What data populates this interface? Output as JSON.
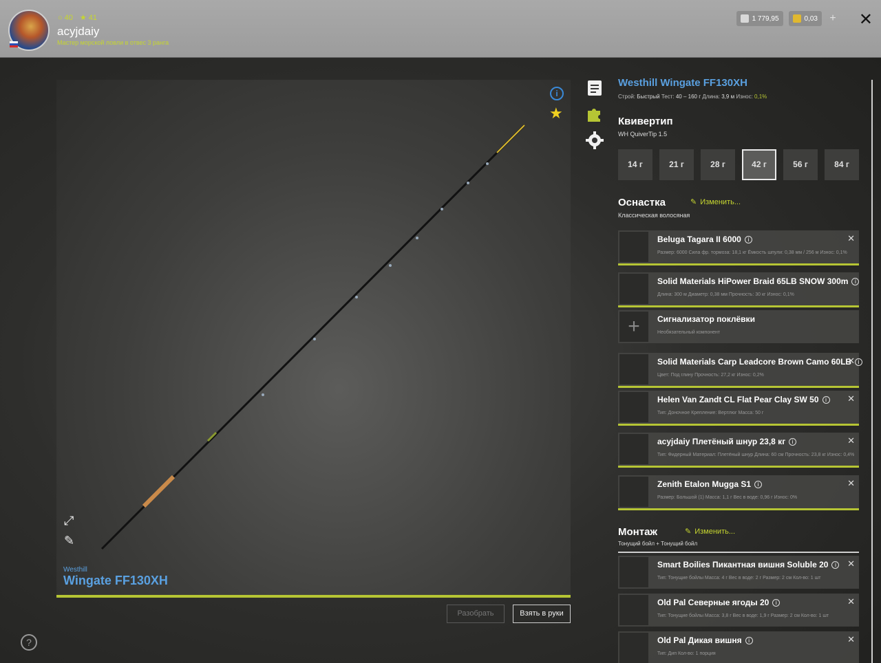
{
  "header": {
    "level": "40",
    "stars": "41",
    "username": "acyjdaiy",
    "rank": "Мастер морской ловли в отвес 3 ранга",
    "silver": "1 779,95",
    "gold": "0,03",
    "plus_label": "+",
    "close_label": "✕"
  },
  "viewer": {
    "brand": "Westhill",
    "model": "Wingate FF130XH",
    "disassemble_label": "Разобрать",
    "take_label": "Взять в руки",
    "help_label": "?"
  },
  "rod": {
    "title": "Westhill Wingate FF130XH",
    "specs_prefix_1": "Строй: ",
    "action": "Быстрый",
    "specs_prefix_2": "Тест: ",
    "test": "40 – 160 г",
    "specs_prefix_3": "Длина: ",
    "length": "3,9 м",
    "specs_prefix_4": "Износ: ",
    "wear": "0,1%"
  },
  "quivertip": {
    "heading": "Квивертип",
    "name": "WH QuiverTip 1.5",
    "options": [
      "14 г",
      "21 г",
      "28 г",
      "42 г",
      "56 г",
      "84 г"
    ],
    "selected_index": 3
  },
  "tackle": {
    "heading": "Оснастка",
    "edit_label": "Изменить...",
    "subtitle": "Классическая волосяная",
    "items": [
      {
        "name": "Beluga Tagara II 6000",
        "meta": "Размер: 6000  Сила фр. тормоза: 18,1 кг  Ёмкость шпули: 0,38 мм / 256 м  Износ: 0,1%"
      },
      {
        "name": "Solid Materials HiPower Braid 65LB SNOW 300m",
        "meta": "Длина: 300 м  Диаметр: 0,38 мм  Прочность: 30 кг  Износ: 0,1%"
      },
      {
        "name": "Сигнализатор поклёвки",
        "meta": "Необязательный компонент"
      },
      {
        "name": "Solid Materials Carp Leadcore Brown Camo 60LB",
        "meta": "Цвет: Под глину  Прочность: 27,2 кг  Износ: 0,2%"
      },
      {
        "name": "Helen Van Zandt CL Flat Pear Clay SW 50",
        "meta": "Тип: Доночное  Крепление: Вертлюг  Масса: 50 г"
      },
      {
        "name": "acyjdaiy Плетёный шнур 23,8 кг",
        "meta": "Тип: Фидерный  Материал: Плетёный шнур  Длина: 60 см  Прочность: 23,8 кг  Износ: 0,4%"
      },
      {
        "name": "Zenith Etalon Mugga S1",
        "meta": "Размер: Большой (1)  Масса: 1,1 г  Вес в воде: 0,96 г  Износ: 0%"
      }
    ]
  },
  "montage": {
    "heading": "Монтаж",
    "edit_label": "Изменить...",
    "subtitle": "Тонущий бойл + Тонущий бойл",
    "items": [
      {
        "name": "Smart Boilies Пикантная вишня Soluble 20",
        "meta": "Тип: Тонущие бойлы  Масса: 4 г  Вес в воде: 2 г  Размер: 2 см  Кол-во: 1 шт"
      },
      {
        "name": "Old Pal Северные ягоды 20",
        "meta": "Тип: Тонущие бойлы  Масса: 3,8 г  Вес в воде: 1,9 г  Размер: 2 см  Кол-во: 1 шт"
      },
      {
        "name": "Old Pal Дикая вишня",
        "meta": "Тип: Дип  Кол-во: 1 порция"
      }
    ]
  },
  "colors": {
    "accent_green": "#b6c534",
    "title_blue": "#5aa0e0",
    "star_yellow": "#f0d020"
  }
}
